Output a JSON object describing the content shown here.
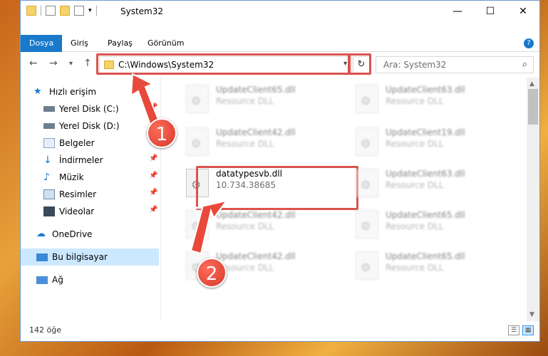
{
  "window": {
    "title": "System32",
    "controls": {
      "minimize": "—",
      "maximize": "☐",
      "close": "✕"
    },
    "help": "?"
  },
  "ribbon": {
    "tabs": [
      {
        "label": "Dosya",
        "active": true
      },
      {
        "label": "Giriş",
        "active": false
      },
      {
        "label": "Paylaş",
        "active": false
      },
      {
        "label": "Görünüm",
        "active": false
      }
    ]
  },
  "nav": {
    "back": "←",
    "forward": "→",
    "recent": "▾",
    "up": "↑",
    "address": "C:\\Windows\\System32",
    "address_dropdown": "▾",
    "refresh": "↻",
    "search_placeholder": "Ara: System32",
    "search_icon": "⌕"
  },
  "sidebar": {
    "items": [
      {
        "label": "Hızlı erişim",
        "icon": "star-icon"
      },
      {
        "label": "Yerel Disk (C:)",
        "icon": "drive-icon",
        "pinned": true
      },
      {
        "label": "Yerel Disk (D:)",
        "icon": "drive-icon",
        "pinned": true
      },
      {
        "label": "Belgeler",
        "icon": "documents-icon",
        "pinned": true
      },
      {
        "label": "İndirmeler",
        "icon": "download-icon",
        "pinned": true
      },
      {
        "label": "Müzik",
        "icon": "music-icon",
        "pinned": true
      },
      {
        "label": "Resimler",
        "icon": "pictures-icon",
        "pinned": true
      },
      {
        "label": "Videolar",
        "icon": "video-icon",
        "pinned": true
      },
      {
        "label": "OneDrive",
        "icon": "cloud-icon"
      },
      {
        "label": "Bu bilgisayar",
        "icon": "computer-icon",
        "selected": true
      },
      {
        "label": "Ağ",
        "icon": "network-icon"
      }
    ],
    "pin_glyph": "📌"
  },
  "files": {
    "col1": [
      {
        "name": "UpdateClient65.dll",
        "sub": "Resource DLL"
      },
      {
        "name": "UpdateClient42.dll",
        "sub": "Resource DLL"
      },
      {
        "name": "datatypesvb.dll",
        "sub": "10.734.38685"
      },
      {
        "name": "UpdateClient42.dll",
        "sub": "Resource DLL"
      },
      {
        "name": "UpdateClient42.dll",
        "sub": "Resource DLL"
      }
    ],
    "col2": [
      {
        "name": "UpdateClient63.dll",
        "sub": "Resource DLL"
      },
      {
        "name": "UpdateClient19.dll",
        "sub": "Resource DLL"
      },
      {
        "name": "UpdateClient63.dll",
        "sub": "Resource DLL"
      },
      {
        "name": "UpdateClient65.dll",
        "sub": "Resource DLL"
      },
      {
        "name": "UpdateClient65.dll",
        "sub": "Resource DLL"
      }
    ]
  },
  "status": {
    "count": "142 öğe",
    "details_view": "☰",
    "tiles_view": "▦"
  },
  "callouts": [
    "1",
    "2"
  ],
  "colors": {
    "accent": "#1979ca",
    "highlight": "#d9534f",
    "selected": "#cce8ff"
  }
}
